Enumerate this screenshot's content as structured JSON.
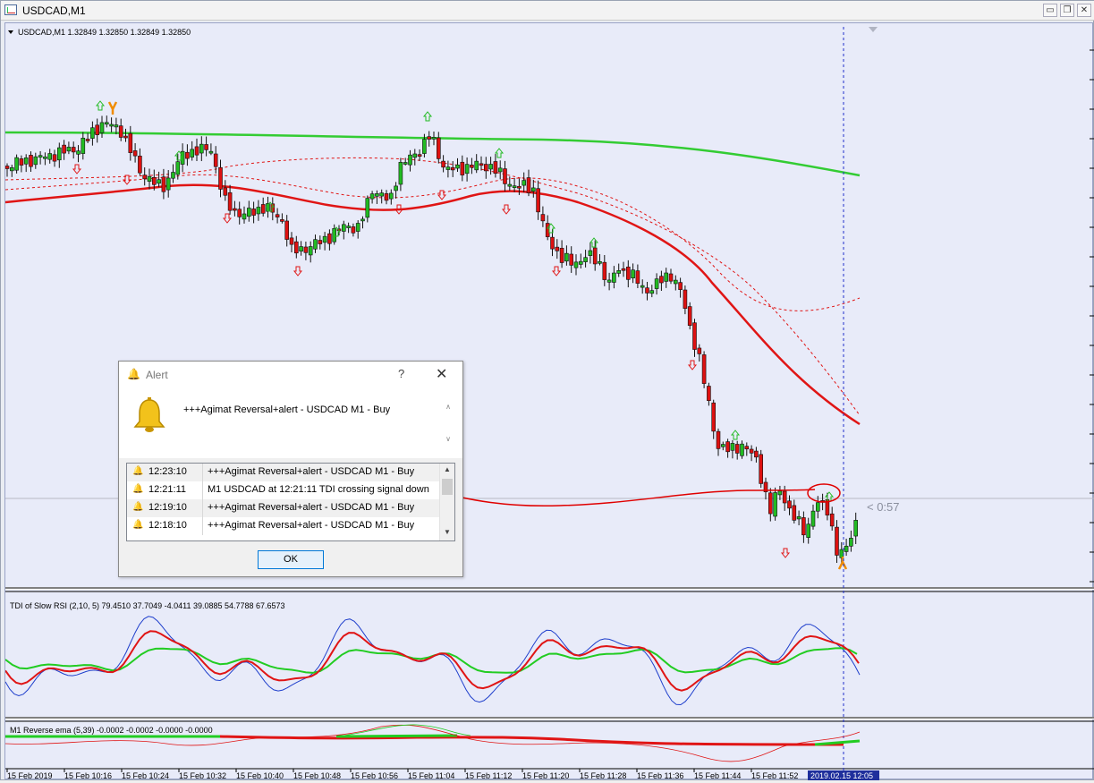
{
  "window": {
    "title": "USDCAD,M1"
  },
  "main_chart": {
    "header": "USDCAD,M1  1.32849 1.32850 1.32849 1.32850",
    "countdown": "< 0:57"
  },
  "tdi_panel": {
    "header": "TDI of Slow RSI  (2,10, 5) 79.4510 37.7049 -4.0411 39.0885 54.7788 67.6573"
  },
  "ema_panel": {
    "header": "M1 Reverse ema (5,39) -0.0002 -0.0002 -0.0000 -0.0000"
  },
  "time_axis": {
    "labels": [
      "15 Feb 2019",
      "15 Feb 10:16",
      "15 Feb 10:24",
      "15 Feb 10:32",
      "15 Feb 10:40",
      "15 Feb 10:48",
      "15 Feb 10:56",
      "15 Feb 11:04",
      "15 Feb 11:12",
      "15 Feb 11:20",
      "15 Feb 11:28",
      "15 Feb 11:36",
      "15 Feb 11:44",
      "15 Feb 11:52"
    ],
    "highlight": "2019.02.15 12:05"
  },
  "alert_dialog": {
    "title": "Alert",
    "help": "?",
    "close": "✕",
    "message": "+++Agimat Reversal+alert - USDCAD  M1 - Buy",
    "rows": [
      {
        "time": "12:23:10",
        "text": "+++Agimat Reversal+alert - USDCAD  M1 - Buy"
      },
      {
        "time": "12:21:11",
        "text": "M1 USDCAD at 12:21:11 TDI crossing signal down"
      },
      {
        "time": "12:19:10",
        "text": "+++Agimat Reversal+alert - USDCAD  M1 - Buy"
      },
      {
        "time": "12:18:10",
        "text": "+++Agimat Reversal+alert - USDCAD  M1 - Buy"
      }
    ],
    "ok_label": "OK"
  },
  "colors": {
    "bull": "#22bb22",
    "bear": "#dd1111",
    "ma_green": "#33cc33",
    "ma_red": "#e01515",
    "background": "#e8ebf9",
    "tdi_blue": "#1f3fcc"
  }
}
